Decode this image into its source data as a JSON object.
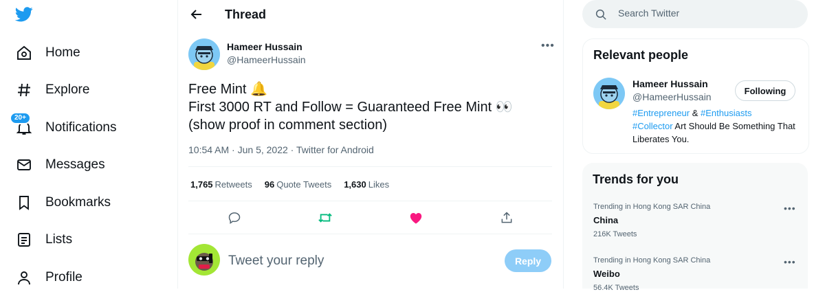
{
  "nav": {
    "items": [
      {
        "label": "Home",
        "icon": "home-icon"
      },
      {
        "label": "Explore",
        "icon": "hashtag-icon"
      },
      {
        "label": "Notifications",
        "icon": "bell-icon",
        "badge": "20+"
      },
      {
        "label": "Messages",
        "icon": "envelope-icon"
      },
      {
        "label": "Bookmarks",
        "icon": "bookmark-icon"
      },
      {
        "label": "Lists",
        "icon": "list-icon"
      },
      {
        "label": "Profile",
        "icon": "person-icon"
      }
    ]
  },
  "header": {
    "title": "Thread"
  },
  "tweet": {
    "author_name": "Hameer Hussain",
    "author_handle": "@HameerHussain",
    "lines": [
      "Free Mint 🔔",
      "First 3000 RT and Follow  = Guaranteed Free Mint 👀",
      "(show proof in comment section)"
    ],
    "time": "10:54 AM",
    "date": "Jun 5, 2022",
    "source": "Twitter for Android",
    "stats": {
      "retweets_count": "1,765",
      "retweets_label": "Retweets",
      "quotes_count": "96",
      "quotes_label": "Quote Tweets",
      "likes_count": "1,630",
      "likes_label": "Likes"
    }
  },
  "reply": {
    "placeholder": "Tweet your reply",
    "button": "Reply"
  },
  "search": {
    "placeholder": "Search Twitter"
  },
  "relevant": {
    "title": "Relevant people",
    "name": "Hameer Hussain",
    "handle": "@HameerHussain",
    "follow_label": "Following",
    "bio_tag1": "#Entrepreneur",
    "bio_amp": " & ",
    "bio_tag2": "#Enthusiasts",
    "bio_tag3": "#Collector",
    "bio_rest": " Art Should Be Something That Liberates You."
  },
  "trends": {
    "title": "Trends for you",
    "items": [
      {
        "context": "Trending in Hong Kong SAR China",
        "name": "China",
        "count": "216K Tweets"
      },
      {
        "context": "Trending in Hong Kong SAR China",
        "name": "Weibo",
        "count": "56.4K Tweets"
      }
    ]
  },
  "colors": {
    "accent": "#1d9bf0",
    "retweet": "#00ba7c",
    "like": "#f91880",
    "reply_button": "#8ecdf8"
  }
}
